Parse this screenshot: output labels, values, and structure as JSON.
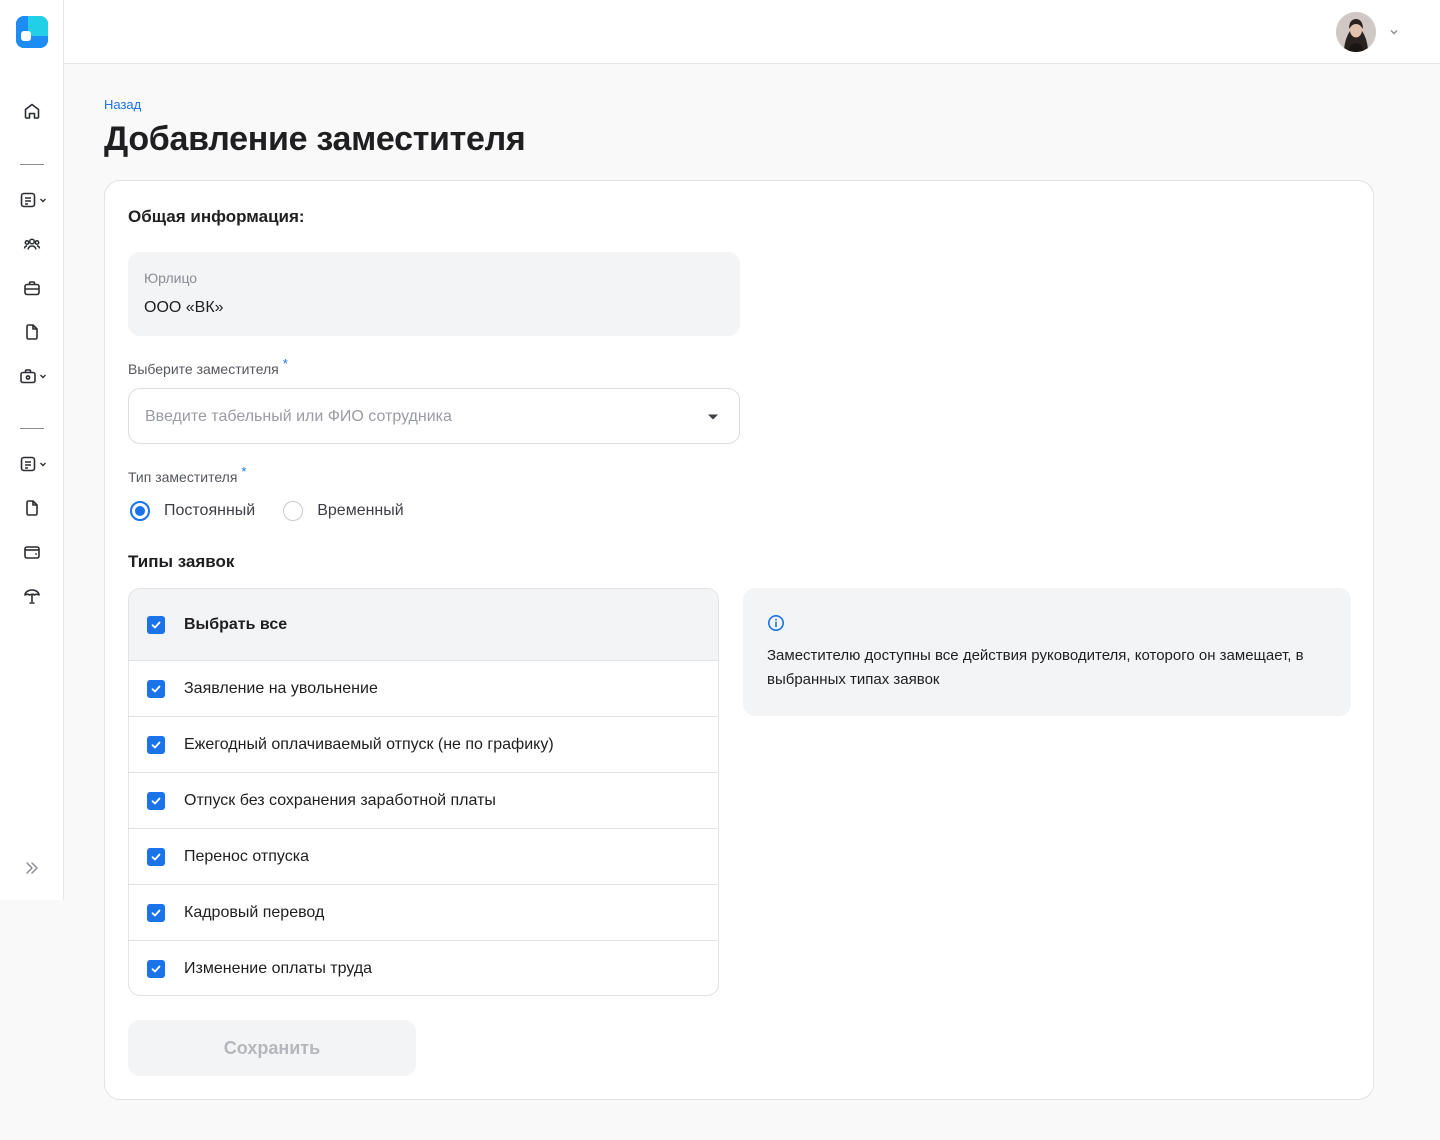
{
  "header": {
    "avatar_alt": "user-avatar"
  },
  "sidebar": {
    "items": [
      {
        "icon": "home-icon"
      },
      {
        "icon": "document-list-icon"
      },
      {
        "icon": "users-icon"
      },
      {
        "icon": "briefcase-icon"
      },
      {
        "icon": "file-icon"
      },
      {
        "icon": "toolbox-icon"
      },
      {
        "icon": "document-list-icon"
      },
      {
        "icon": "file-icon"
      },
      {
        "icon": "wallet-icon"
      },
      {
        "icon": "umbrella-icon"
      },
      {
        "icon": "double-chevron-right-icon"
      }
    ]
  },
  "main": {
    "back_label": "Назад",
    "title": "Добавление заместителя",
    "section_title": "Общая информация:",
    "legal_entity": {
      "label": "Юрлицо",
      "value": "ООО «ВК»"
    },
    "deputy_select": {
      "label": "Выберите заместителя",
      "required_mark": "*",
      "placeholder": "Введите табельный или ФИО сотрудника"
    },
    "deputy_type": {
      "label": "Тип заместителя",
      "required_mark": "*",
      "options": [
        {
          "label": "Постоянный",
          "selected": true
        },
        {
          "label": "Временный",
          "selected": false
        }
      ]
    },
    "request_types": {
      "title": "Типы заявок",
      "select_all": "Выбрать все",
      "items": [
        {
          "label": "Заявление на увольнение",
          "checked": true
        },
        {
          "label": "Ежегодный оплачиваемый отпуск (не по графику)",
          "checked": true
        },
        {
          "label": "Отпуск без сохранения заработной платы",
          "checked": true
        },
        {
          "label": "Перенос отпуска",
          "checked": true
        },
        {
          "label": "Кадровый перевод",
          "checked": true
        },
        {
          "label": "Изменение оплаты труда",
          "checked": true
        }
      ]
    },
    "info_text": "Заместителю доступны все действия руководителя, которого он замещает, в выбранных типах заявок",
    "save_label": "Сохранить"
  },
  "colors": {
    "accent": "#1a73e8",
    "background": "#f9f9fa",
    "panel": "#f3f4f6"
  }
}
